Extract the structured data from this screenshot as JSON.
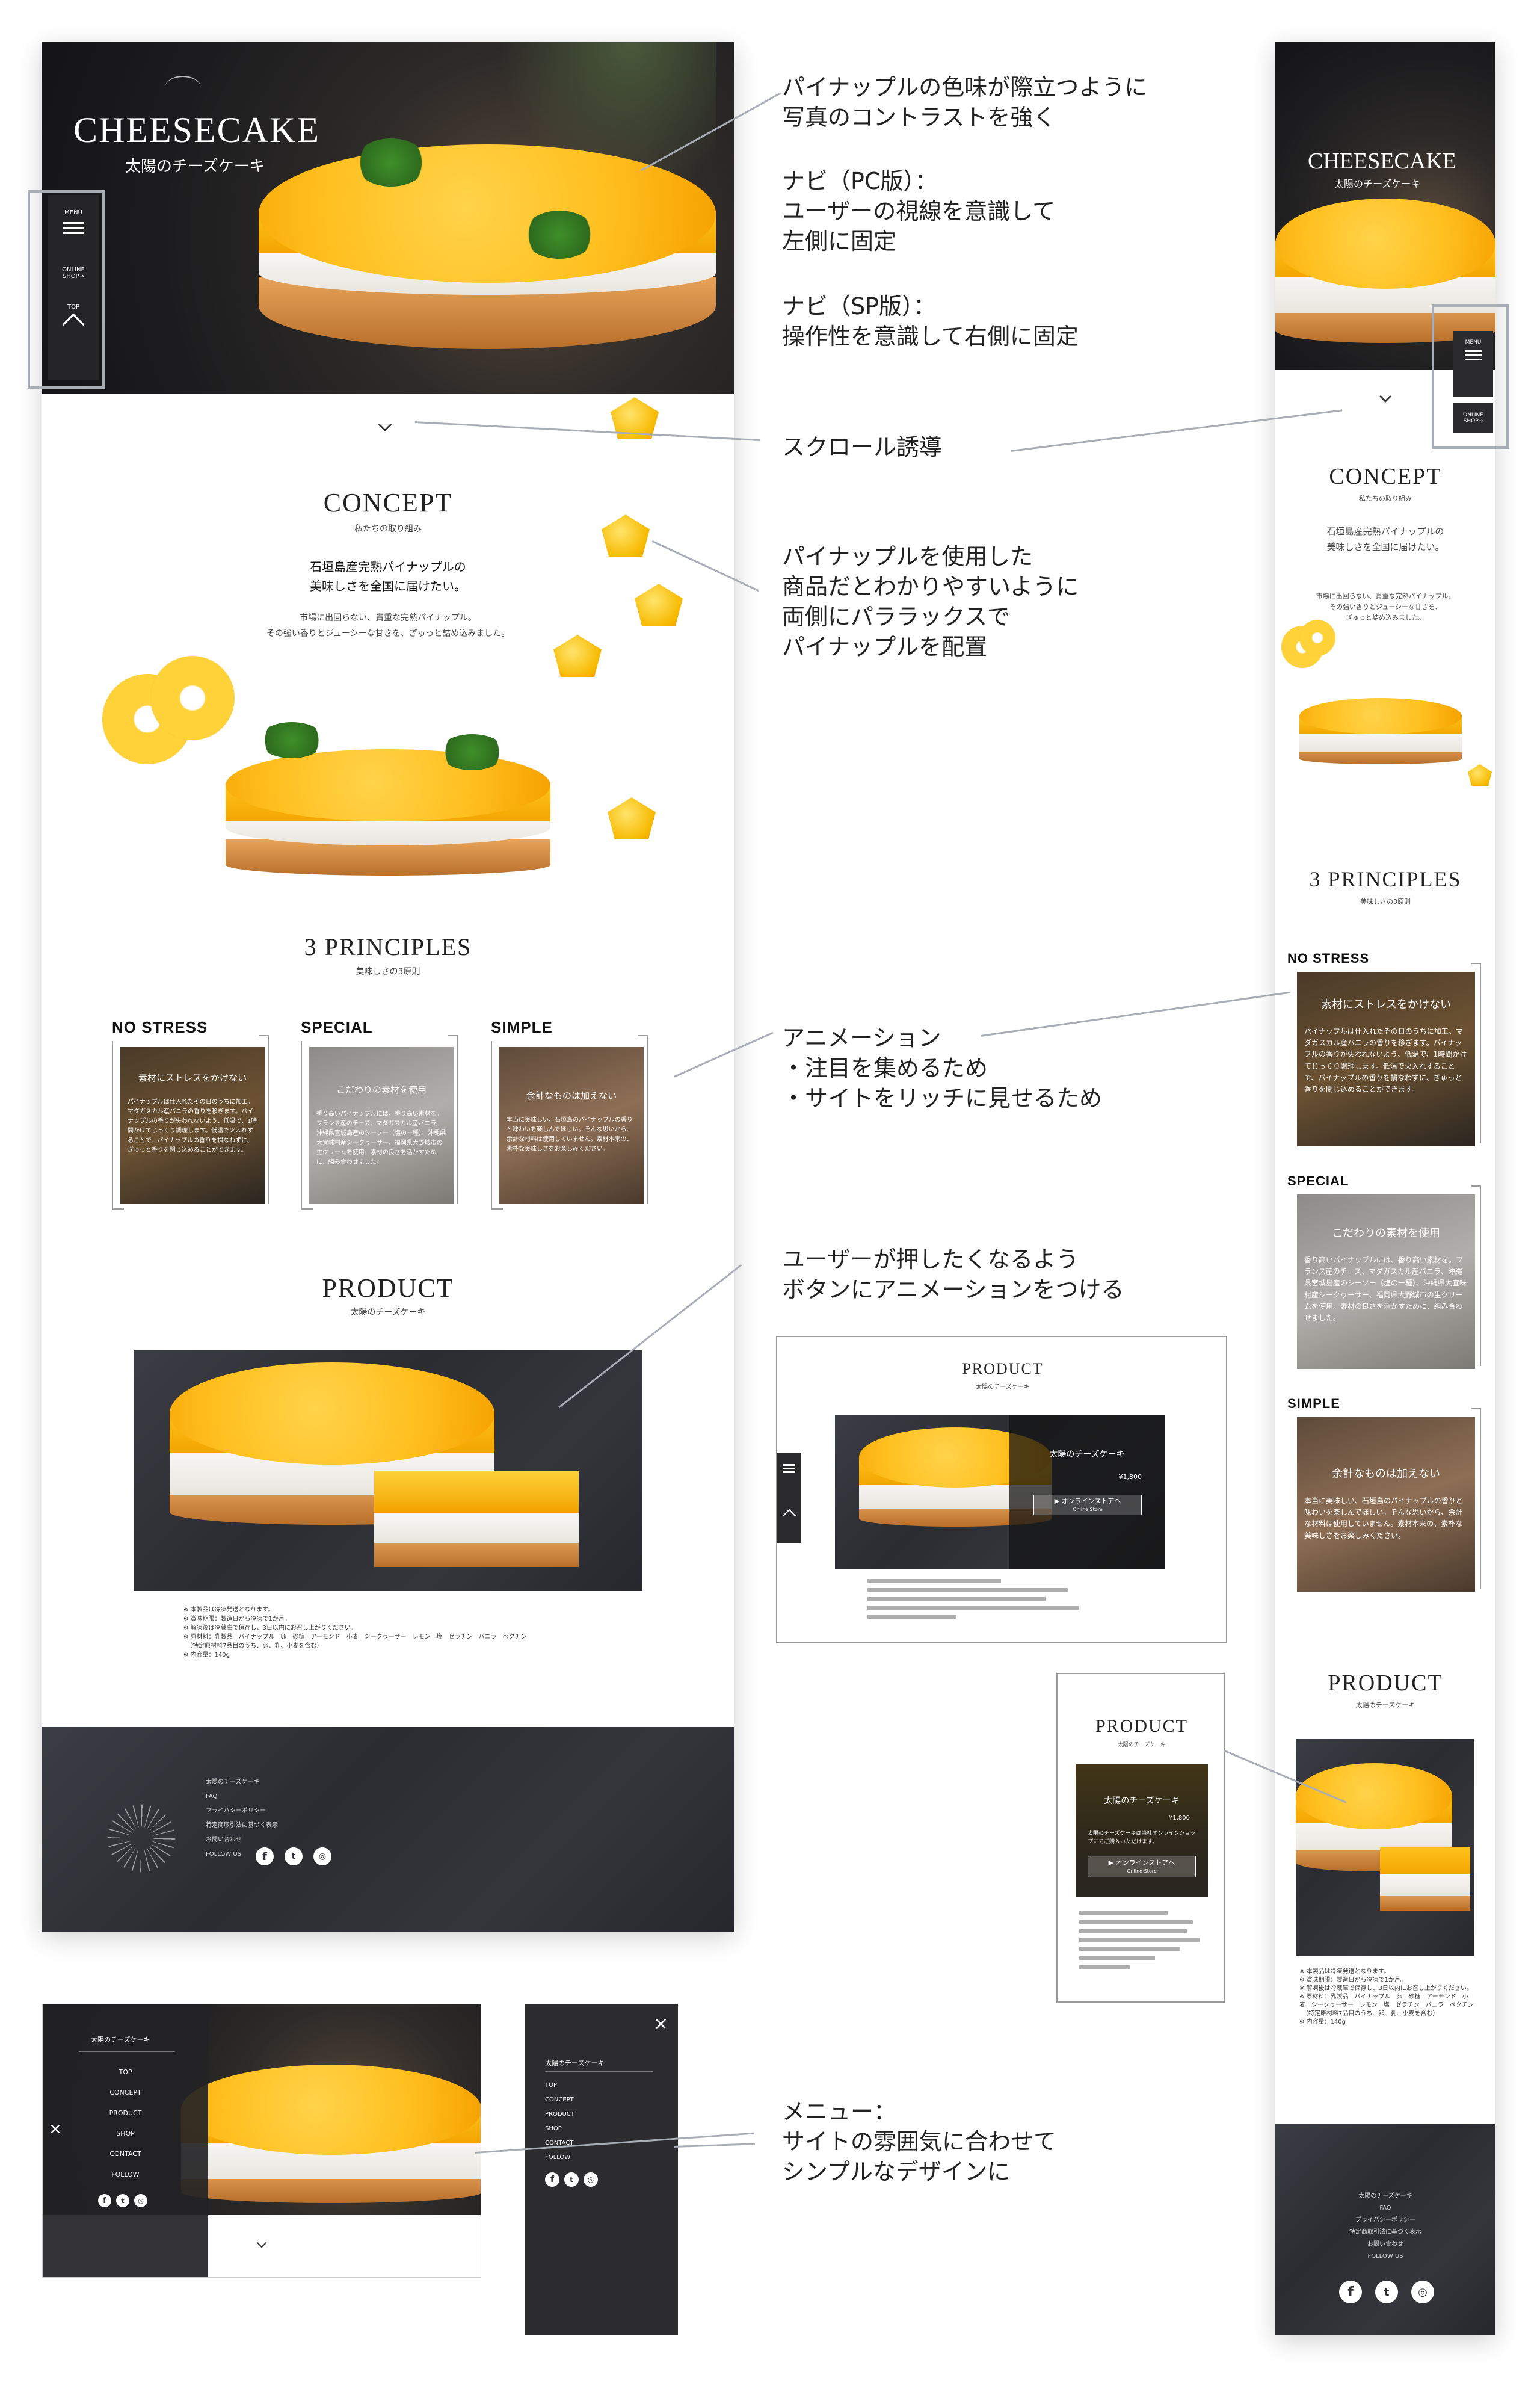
{
  "hero": {
    "title": "CHEESECAKE",
    "subtitle": "太陽のチーズケーキ"
  },
  "nav_pc": {
    "menu": "MENU",
    "online_shop": "ONLINE\nSHOP→",
    "top": "TOP"
  },
  "nav_sp": {
    "menu": "MENU",
    "online_shop": "ONLINE\nSHOP→"
  },
  "concept": {
    "title": "CONCEPT",
    "subtitle": "私たちの取り組み",
    "lead": "石垣島産完熟パイナップルの\n美味しさを全国に届けたい。",
    "body": "市場に出回らない、貴重な完熟パイナップル。\nその強い香りとジューシーな甘さを、ぎゅっと詰め込みました。",
    "body_sp": "市場に出回らない、貴重な完熟パイナップル。\nその強い香りとジューシーな甘さを、\nぎゅっと詰め込みました。"
  },
  "principles": {
    "title": "3 PRINCIPLES",
    "subtitle": "美味しさの3原則",
    "items": [
      {
        "label": "NO STRESS",
        "heading": "素材にストレスをかけない",
        "text": "パイナップルは仕入れたその日のうちに加工。マダガスカル産バニラの香りを移ぎます。パイナップルの香りが失われないよう、低温で、1時間かけてじっくり調理します。低温で火入れすることで、パイナップルの香りを損なわずに、ぎゅっと香りを閉じ込めることができます。"
      },
      {
        "label": "SPECIAL",
        "heading": "こだわりの素材を使用",
        "text": "香り高いパイナップルには、香り高い素材を。フランス産のチーズ、マダガスカル産バニラ、沖縄県宮城島産のシーソー（塩の一種）、沖縄県大宜味村産シークヮーサー、福岡県大野城市の生クリームを使用。素材の良さを活かすために、組み合わせました。"
      },
      {
        "label": "SIMPLE",
        "heading": "余計なものは加えない",
        "text": "本当に美味しい、石垣島のパイナップルの香りと味わいを楽しんでほしい。そんな思いから、余計な材料は使用していません。素材本来の、素朴な美味しさをお楽しみください。"
      }
    ]
  },
  "product": {
    "title": "PRODUCT",
    "subtitle": "太陽のチーズケーキ",
    "overlay_title": "太陽のチーズケーキ",
    "price": "¥1,800",
    "overlay_desc": "太陽のチーズケーキは当社オンラインショップにてご購入いただけます。",
    "shop_button": "▶ オンラインストアへ",
    "shop_button_sub": "Online Store",
    "notes": [
      "※ 本製品は冷凍発送となります。",
      "※ 賞味期限：製造日から冷凍で1か月。",
      "※ 解凍後は冷蔵庫で保存し、3日以内にお召し上がりください。",
      "※ 原材料：乳製品　パイナップル　卵　砂糖　アーモンド　小麦　シークヮーサー　レモン　塩　ゼラチン　バニラ　ペクチン",
      "　（特定原材料7品目のうち、卵、乳、小麦を含む）",
      "※ 内容量：140g"
    ]
  },
  "footer": {
    "links": [
      "太陽のチーズケーキ",
      "FAQ",
      "プライバシーポリシー",
      "特定商取引法に基づく表示",
      "お問い合わせ",
      "FOLLOW US"
    ]
  },
  "menu_panel": {
    "brand": "太陽のチーズケーキ",
    "items": [
      "TOP",
      "CONCEPT",
      "PRODUCT",
      "SHOP",
      "CONTACT",
      "FOLLOW"
    ],
    "close": "×"
  },
  "annotations": [
    "パイナップルの色味が際立つように\n写真のコントラストを強く",
    "ナビ（PC版）：\nユーザーの視線を意識して\n左側に固定",
    "ナビ（SP版）：\n操作性を意識して右側に固定",
    "スクロール誘導",
    "パイナップルを使用した\n商品だとわかりやすいように\n両側にパララックスで\nパイナップルを配置",
    "アニメーション\n・注目を集めるため\n・サイトをリッチに見せるため",
    "ユーザーが押したくなるよう\nボタンにアニメーションをつける",
    "メニュー：\nサイトの雰囲気に合わせて\nシンプルなデザインに"
  ],
  "icons": {
    "menu": "hamburger-icon",
    "close": "close-icon",
    "up": "chevron-up-icon",
    "down": "chevron-down-icon",
    "social": [
      "facebook-icon",
      "twitter-icon",
      "instagram-icon"
    ],
    "logo": "sunburst-logo-icon"
  },
  "colors": {
    "accent": "#f7b500",
    "dark": "#2c2e33",
    "annotation_line": "#a9adb5"
  }
}
